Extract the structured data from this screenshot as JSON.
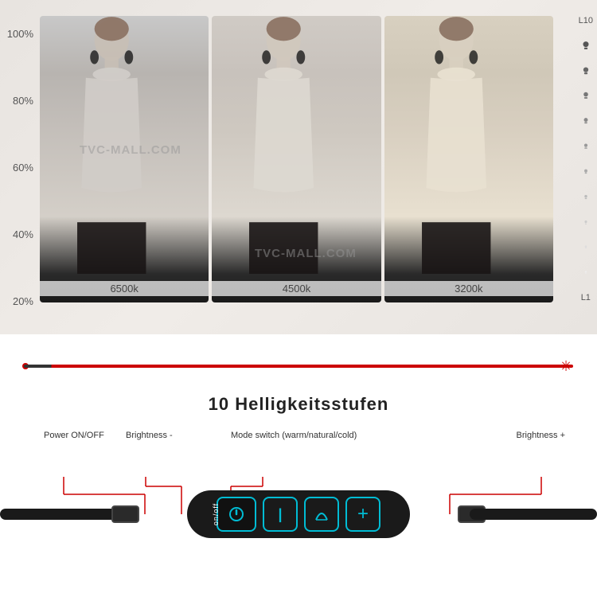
{
  "watermark": "TVC-MALL.COM",
  "brightness": {
    "label": "10 Helligkeitsstufen",
    "sublabel": "Brightness"
  },
  "y_axis": {
    "labels": [
      "100%",
      "80%",
      "60%",
      "40%",
      "20%"
    ]
  },
  "l_scale": {
    "top": "L10",
    "bottom": "L1"
  },
  "panels": [
    {
      "label": "6500k",
      "tone": "cool"
    },
    {
      "label": "4500k",
      "tone": "neutral"
    },
    {
      "label": "3200k",
      "tone": "warm"
    }
  ],
  "device": {
    "onoff_label": "on/off",
    "buttons": [
      {
        "icon": "G",
        "type": "power"
      },
      {
        "icon": "|",
        "type": "brightness-minus"
      },
      {
        "icon": "S",
        "type": "mode"
      },
      {
        "icon": "+",
        "type": "brightness-plus"
      }
    ]
  },
  "labels": {
    "power": "Power ON/OFF",
    "brightness_minus": "Brightness -",
    "mode_switch": "Mode switch  (warm/natural/cold)",
    "brightness_plus": "Brightness +"
  }
}
